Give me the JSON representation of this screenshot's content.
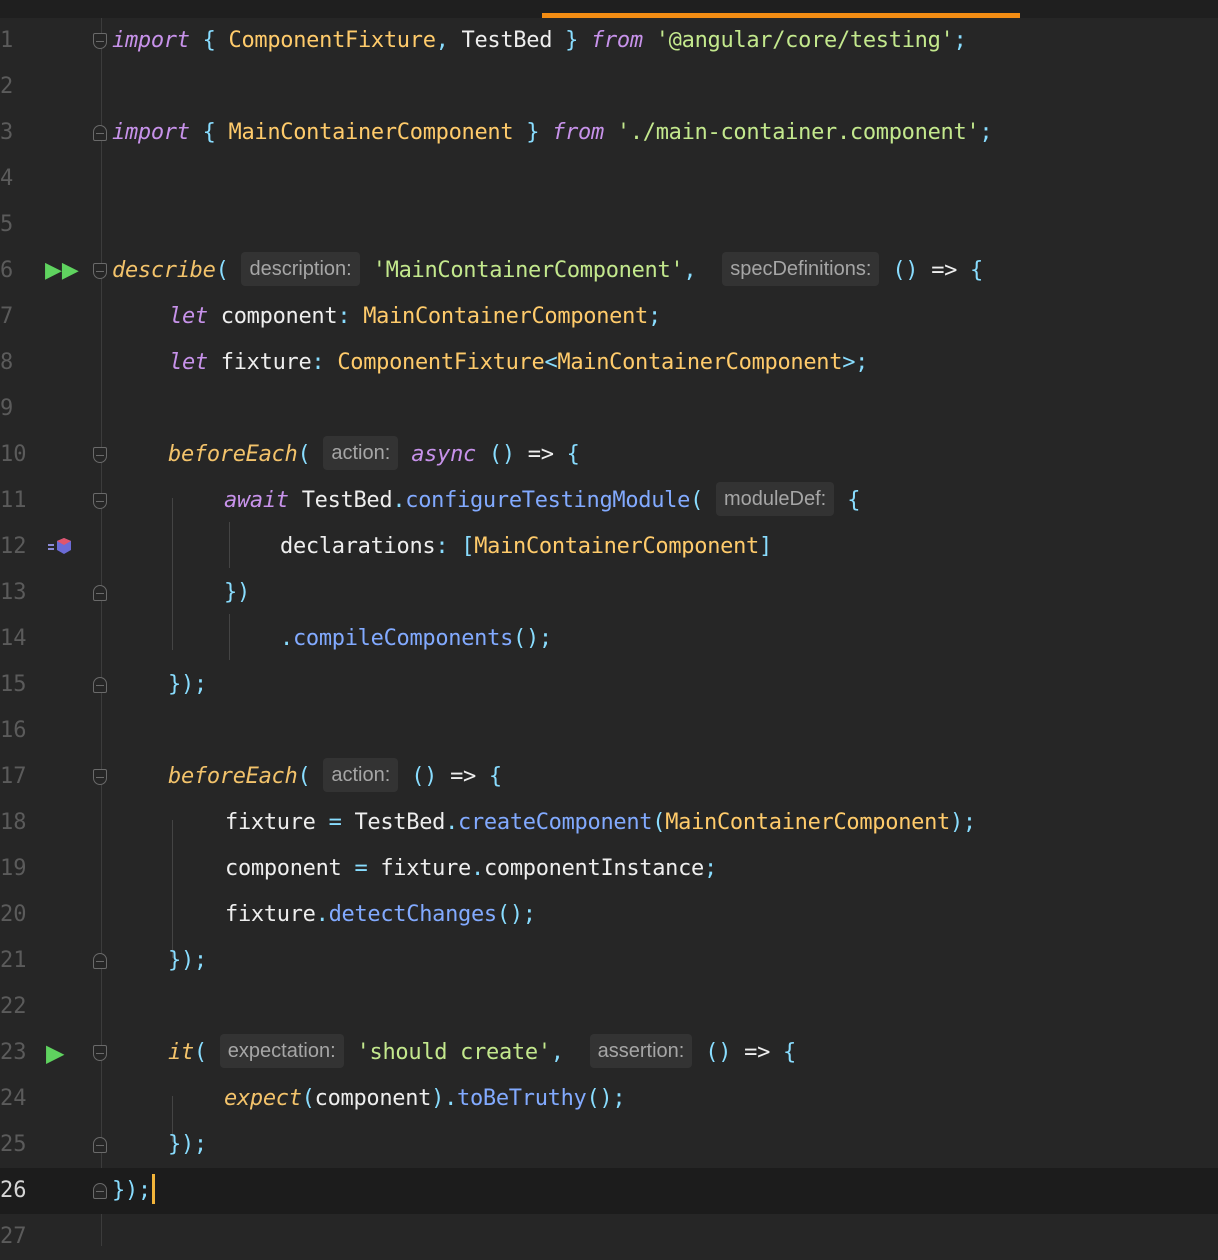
{
  "editor": {
    "language": "typescript",
    "cursor_line": 26,
    "lines": [
      {
        "n": "1"
      },
      {
        "n": "2"
      },
      {
        "n": "3"
      },
      {
        "n": "4"
      },
      {
        "n": "5"
      },
      {
        "n": "6"
      },
      {
        "n": "7"
      },
      {
        "n": "8"
      },
      {
        "n": "9"
      },
      {
        "n": "10"
      },
      {
        "n": "11"
      },
      {
        "n": "12"
      },
      {
        "n": "13"
      },
      {
        "n": "14"
      },
      {
        "n": "15"
      },
      {
        "n": "16"
      },
      {
        "n": "17"
      },
      {
        "n": "18"
      },
      {
        "n": "19"
      },
      {
        "n": "20"
      },
      {
        "n": "21"
      },
      {
        "n": "22"
      },
      {
        "n": "23"
      },
      {
        "n": "24"
      },
      {
        "n": "25"
      },
      {
        "n": "26"
      },
      {
        "n": "27"
      }
    ],
    "tokens": {
      "l1": [
        "import",
        " { ",
        "ComponentFixture",
        ", ",
        "TestBed",
        " } ",
        "from",
        " ",
        "'@angular/core/testing'",
        ";"
      ],
      "l3": [
        "import",
        " { ",
        "MainContainerComponent",
        " } ",
        "from",
        " ",
        "'./main-container.component'",
        ";"
      ],
      "l6": [
        "describe",
        "( ",
        "description:",
        " ",
        "'MainContainerComponent'",
        ",  ",
        "specDefinitions:",
        " ",
        "()",
        " => ",
        "{"
      ],
      "l7": [
        "let",
        " ",
        "component",
        ": ",
        "MainContainerComponent",
        ";"
      ],
      "l8": [
        "let",
        " ",
        "fixture",
        ": ",
        "ComponentFixture",
        "<",
        "MainContainerComponent",
        ">;"
      ],
      "l10": [
        "beforeEach",
        "( ",
        "action:",
        " ",
        "async",
        " ",
        "()",
        " => ",
        "{"
      ],
      "l11": [
        "await",
        " ",
        "TestBed",
        ".",
        "configureTestingModule",
        "( ",
        "moduleDef:",
        " ",
        "{"
      ],
      "l12": [
        "declarations",
        ": ",
        "[",
        "MainContainerComponent",
        "]"
      ],
      "l13": [
        "})"
      ],
      "l14": [
        ".",
        "compileComponents",
        "();"
      ],
      "l15": [
        "});"
      ],
      "l17": [
        "beforeEach",
        "( ",
        "action:",
        " ",
        "()",
        " => ",
        "{"
      ],
      "l18": [
        "fixture",
        " = ",
        "TestBed",
        ".",
        "createComponent",
        "(",
        "MainContainerComponent",
        ");"
      ],
      "l19": [
        "component",
        " = ",
        "fixture",
        ".",
        "componentInstance",
        ";"
      ],
      "l20": [
        "fixture",
        ".",
        "detectChanges",
        "();"
      ],
      "l21": [
        "});"
      ],
      "l23": [
        "it",
        "( ",
        "expectation:",
        " ",
        "'should create'",
        ",  ",
        "assertion:",
        " ",
        "()",
        " => ",
        "{"
      ],
      "l24": [
        "expect",
        "(",
        "component",
        ").",
        "toBeTruthy",
        "();"
      ],
      "l25": [
        "});"
      ],
      "l26": [
        "});"
      ]
    },
    "gutter_icons": {
      "l6": "run-all-icon",
      "l12": "component-link-icon",
      "l23": "run-test-icon"
    },
    "colors": {
      "background": "#262626",
      "keyword": "#c792ea",
      "function": "#f3c36b",
      "type": "#ffcb6b",
      "string": "#c3e88d",
      "punctuation": "#89ddff",
      "method": "#82aaff",
      "tab_indicator": "#f28c13",
      "caret": "#f2b43a"
    }
  }
}
